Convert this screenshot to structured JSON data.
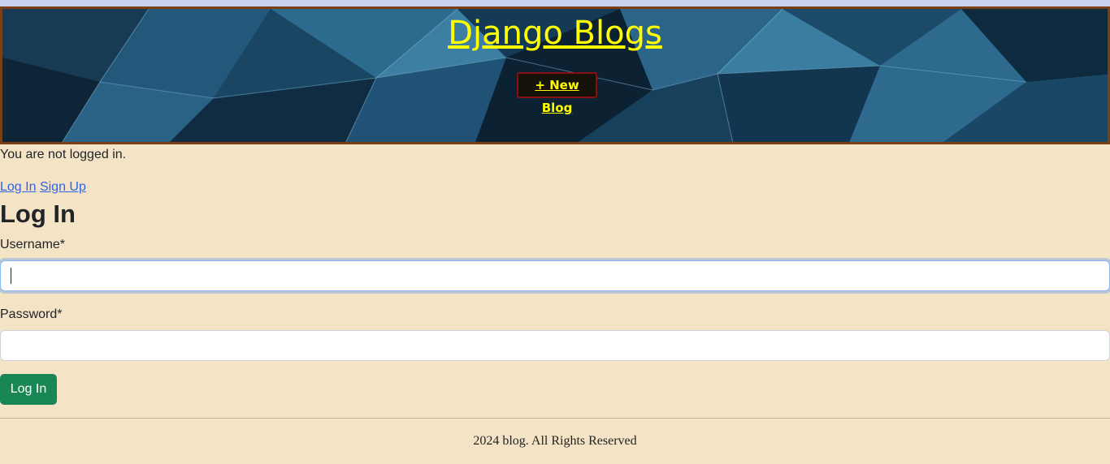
{
  "header": {
    "title": "Django Blogs",
    "new_blog_label": "+ New Blog"
  },
  "auth": {
    "status_text": "You are not logged in.",
    "login_link": "Log In",
    "signup_link": "Sign Up"
  },
  "form": {
    "heading": "Log In",
    "username_label": "Username*",
    "username_value": "",
    "password_label": "Password*",
    "password_value": "",
    "submit_label": "Log In"
  },
  "footer": {
    "text": "2024 blog. All Rights Reserved"
  },
  "colors": {
    "page_background": "#f5e3c6",
    "title": "#ffff00",
    "link": "#2f64e8",
    "submit_button": "#198754",
    "banner_border": "#7a3f14"
  }
}
